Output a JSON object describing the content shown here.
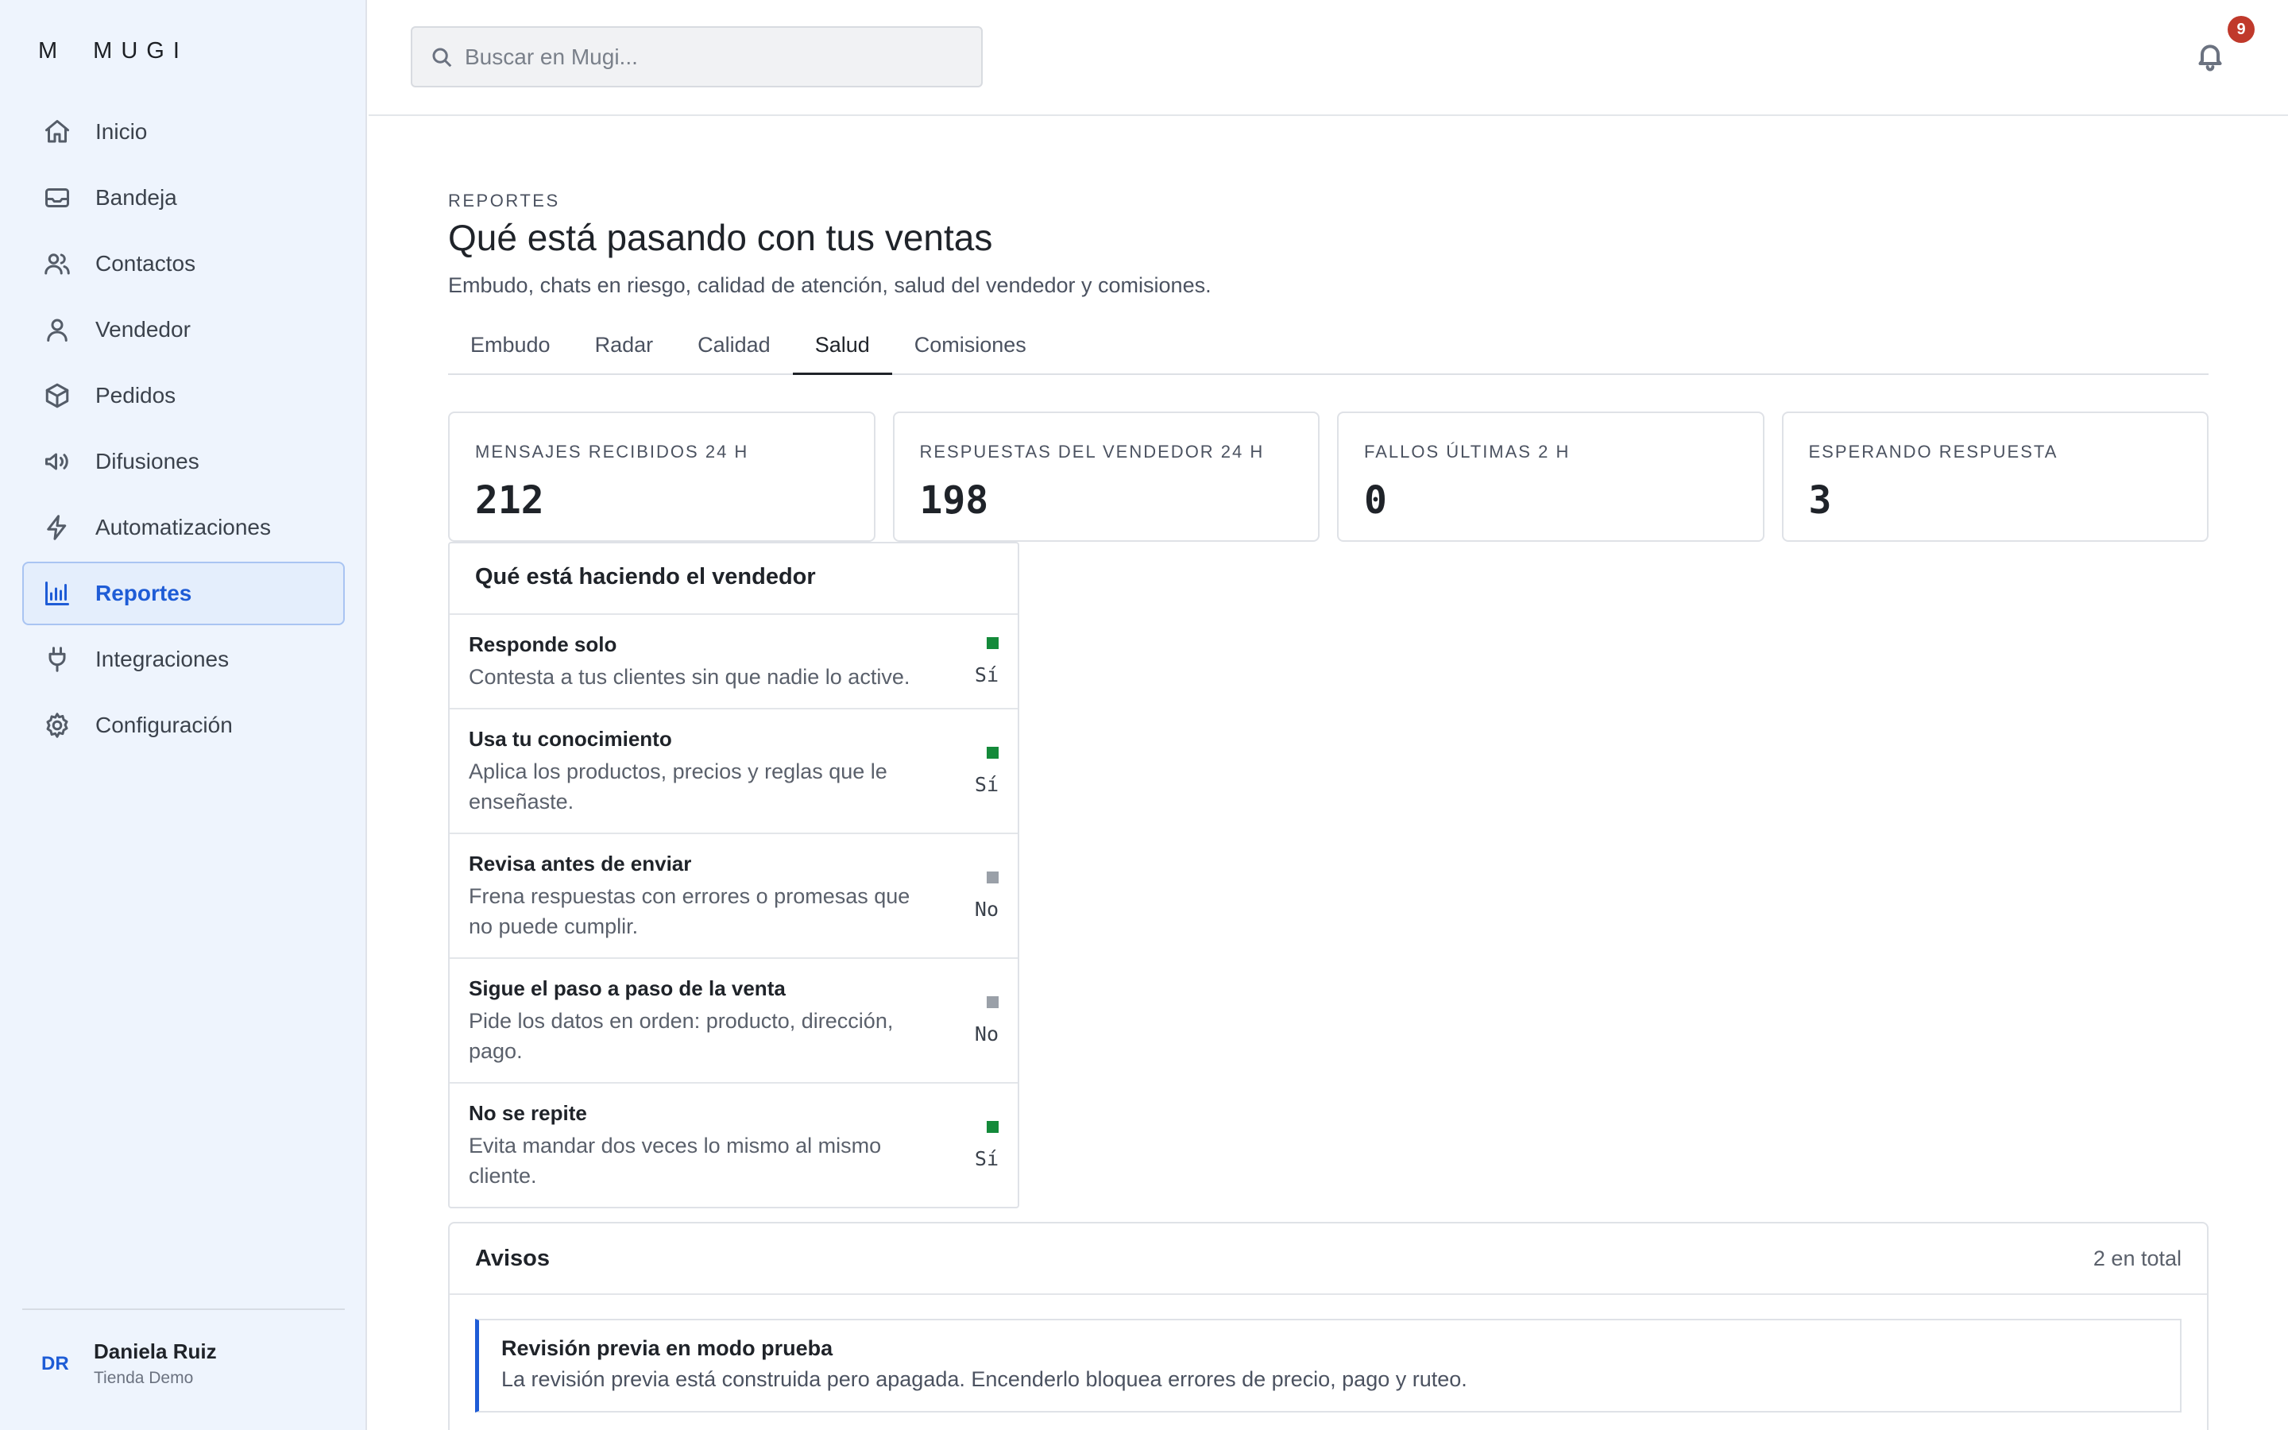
{
  "brand": {
    "letter": "M",
    "name": "MUGI"
  },
  "sidebar": {
    "items": [
      {
        "label": "Inicio",
        "icon": "home-icon"
      },
      {
        "label": "Bandeja",
        "icon": "inbox-icon"
      },
      {
        "label": "Contactos",
        "icon": "users-icon"
      },
      {
        "label": "Vendedor",
        "icon": "user-icon"
      },
      {
        "label": "Pedidos",
        "icon": "box-icon"
      },
      {
        "label": "Difusiones",
        "icon": "megaphone-icon"
      },
      {
        "label": "Automatizaciones",
        "icon": "bolt-icon"
      },
      {
        "label": "Reportes",
        "icon": "bar-chart-icon",
        "active": true
      },
      {
        "label": "Integraciones",
        "icon": "plug-icon"
      },
      {
        "label": "Configuración",
        "icon": "gear-icon"
      }
    ]
  },
  "user": {
    "initials": "DR",
    "name": "Daniela Ruiz",
    "store": "Tienda Demo"
  },
  "topbar": {
    "search_placeholder": "Buscar en Mugi...",
    "notifications": "9"
  },
  "page": {
    "eyebrow": "REPORTES",
    "title": "Qué está pasando con tus ventas",
    "subtitle": "Embudo, chats en riesgo, calidad de atención, salud del vendedor y comisiones."
  },
  "tabs": [
    {
      "label": "Embudo"
    },
    {
      "label": "Radar"
    },
    {
      "label": "Calidad"
    },
    {
      "label": "Salud",
      "active": true
    },
    {
      "label": "Comisiones"
    }
  ],
  "stats": [
    {
      "label": "MENSAJES RECIBIDOS 24 H",
      "value": "212"
    },
    {
      "label": "RESPUESTAS DEL VENDEDOR 24 H",
      "value": "198"
    },
    {
      "label": "FALLOS ÚLTIMAS 2 H",
      "value": "0"
    },
    {
      "label": "ESPERANDO RESPUESTA",
      "value": "3"
    }
  ],
  "vendor_panel": {
    "title": "Qué está haciendo el vendedor",
    "rows": [
      {
        "title": "Responde solo",
        "desc": "Contesta a tus clientes sin que nadie lo active.",
        "status": "Sí",
        "on": true
      },
      {
        "title": "Usa tu conocimiento",
        "desc": "Aplica los productos, precios y reglas que le enseñaste.",
        "status": "Sí",
        "on": true
      },
      {
        "title": "Revisa antes de enviar",
        "desc": "Frena respuestas con errores o promesas que no puede cumplir.",
        "status": "No",
        "on": false
      },
      {
        "title": "Sigue el paso a paso de la venta",
        "desc": "Pide los datos en orden: producto, dirección, pago.",
        "status": "No",
        "on": false
      },
      {
        "title": "No se repite",
        "desc": "Evita mandar dos veces lo mismo al mismo cliente.",
        "status": "Sí",
        "on": true
      }
    ]
  },
  "avisos": {
    "title": "Avisos",
    "count": "2 en total",
    "items": [
      {
        "title": "Revisión previa en modo prueba",
        "text": "La revisión previa está construida pero apagada. Encenderlo bloquea errores de precio, pago y ruteo."
      }
    ]
  },
  "colors": {
    "accent": "#1e5cd6",
    "on": "#148a3a",
    "off": "#9aa0a8",
    "badge": "#c0392b"
  }
}
